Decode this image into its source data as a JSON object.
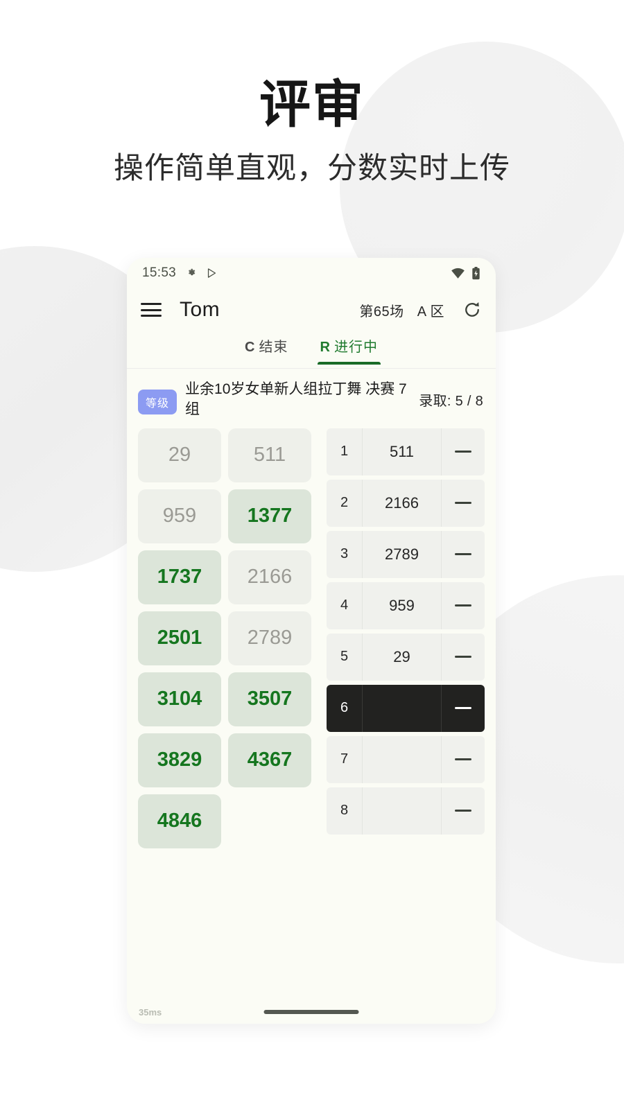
{
  "hero": {
    "title": "评审",
    "subtitle": "操作简单直观，分数实时上传"
  },
  "colors": {
    "phone_bg": "#fbfcf5",
    "accent_green": "#15761f",
    "tab_active": "#1f7a2e",
    "tile_on_bg": "#dce5d9",
    "tile_off_bg": "#eef0ea",
    "badge_bg": "#8c9bf2",
    "row_bg": "#f0f1ed",
    "row_selected_bg": "#222220"
  },
  "statusbar": {
    "time": "15:53",
    "icons_left": [
      "gear-icon",
      "play-triangle-icon"
    ],
    "icons_right": [
      "wifi-icon",
      "battery-charging-icon"
    ]
  },
  "appbar": {
    "menu_icon": "hamburger-menu-icon",
    "title": "Tom",
    "round": "第65场",
    "zone": "A 区",
    "refresh_icon": "refresh-icon"
  },
  "tabs": [
    {
      "key": "C",
      "label": "结束",
      "active": false
    },
    {
      "key": "R",
      "label": "进行中",
      "active": true
    }
  ],
  "event": {
    "badge": "等级",
    "name": "业余10岁女单新人组拉丁舞 决赛 7组",
    "quota_label": "录取: 5 / 8"
  },
  "tiles": [
    {
      "number": "29",
      "selected": false
    },
    {
      "number": "511",
      "selected": false
    },
    {
      "number": "959",
      "selected": false
    },
    {
      "number": "1377",
      "selected": true
    },
    {
      "number": "1737",
      "selected": true
    },
    {
      "number": "2166",
      "selected": false
    },
    {
      "number": "2501",
      "selected": true
    },
    {
      "number": "2789",
      "selected": false
    },
    {
      "number": "3104",
      "selected": true
    },
    {
      "number": "3507",
      "selected": true
    },
    {
      "number": "3829",
      "selected": true
    },
    {
      "number": "4367",
      "selected": true
    },
    {
      "number": "4846",
      "selected": true
    }
  ],
  "ranking": [
    {
      "position": "1",
      "number": "511",
      "score": "—",
      "selected": false
    },
    {
      "position": "2",
      "number": "2166",
      "score": "—",
      "selected": false
    },
    {
      "position": "3",
      "number": "2789",
      "score": "—",
      "selected": false
    },
    {
      "position": "4",
      "number": "959",
      "score": "—",
      "selected": false
    },
    {
      "position": "5",
      "number": "29",
      "score": "—",
      "selected": false
    },
    {
      "position": "6",
      "number": "",
      "score": "—",
      "selected": true
    },
    {
      "position": "7",
      "number": "",
      "score": "—",
      "selected": false
    },
    {
      "position": "8",
      "number": "",
      "score": "—",
      "selected": false
    }
  ],
  "footer": {
    "latency": "35ms"
  }
}
